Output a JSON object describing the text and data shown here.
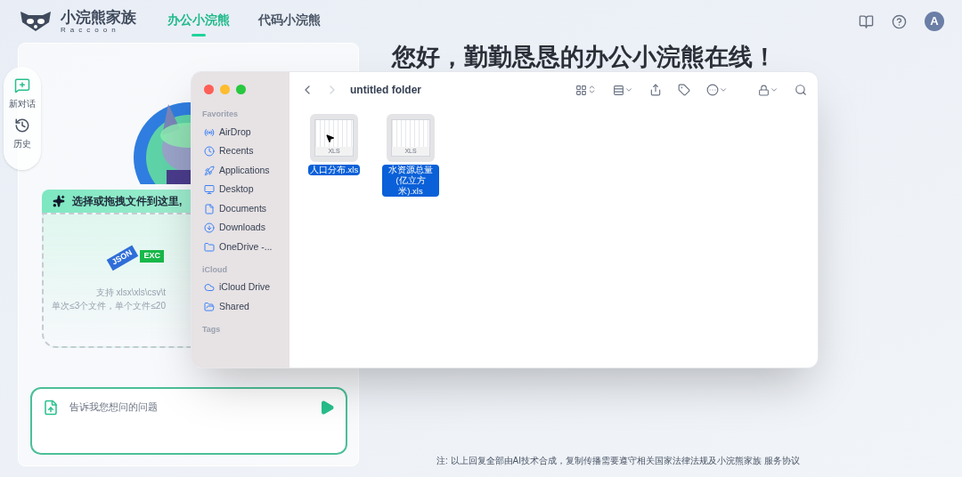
{
  "brand": {
    "title": "小浣熊家族",
    "subtitle": "Raccoon"
  },
  "tabs": [
    {
      "label": "办公小浣熊",
      "selected": true
    },
    {
      "label": "代码小浣熊",
      "selected": false
    }
  ],
  "avatar": "A",
  "side_actions": [
    {
      "label": "新对话"
    },
    {
      "label": "历史"
    }
  ],
  "upload": {
    "heading": "选择或拖拽文件到这里,",
    "file_badges": [
      "JSON",
      "EXC"
    ],
    "hints": [
      "支持 xlsx\\xls\\csv\\t",
      "单次≤3个文件，单个文件≤20"
    ]
  },
  "chat_input": {
    "placeholder": "告诉我您想问的问题"
  },
  "headline": "您好，勤勤恳恳的办公小浣熊在线！",
  "finder": {
    "title": "untitled folder",
    "sections": [
      {
        "heading": "Favorites",
        "items": [
          {
            "label": "AirDrop"
          },
          {
            "label": "Recents"
          },
          {
            "label": "Applications"
          },
          {
            "label": "Desktop"
          },
          {
            "label": "Documents"
          },
          {
            "label": "Downloads"
          },
          {
            "label": "OneDrive -..."
          }
        ]
      },
      {
        "heading": "iCloud",
        "items": [
          {
            "label": "iCloud Drive"
          },
          {
            "label": "Shared"
          }
        ]
      },
      {
        "heading": "Tags"
      }
    ],
    "files": [
      {
        "name": "人口分布.xls",
        "badge": "XLS",
        "selected": true
      },
      {
        "name": "水资源总量 (亿立方米).xls",
        "badge": "XLS",
        "selected": true
      }
    ]
  },
  "footer": "注: 以上回复全部由AI技术合成，复制传播需要遵守相关国家法律法规及小浣熊家族 服务协议"
}
